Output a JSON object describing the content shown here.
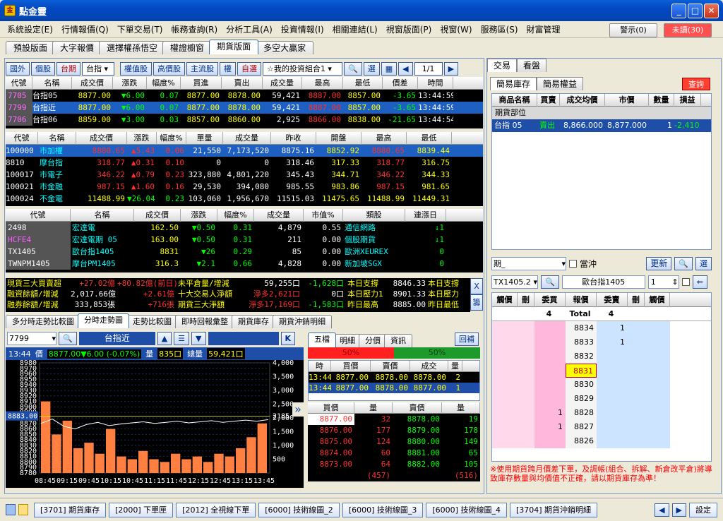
{
  "window": {
    "title": "點金靈"
  },
  "menu": [
    "系統設定(E)",
    "行情報價(Q)",
    "下單交易(T)",
    "帳務查詢(R)",
    "分析工具(A)",
    "投資情報(I)",
    "相關連結(L)",
    "視窗版面(P)",
    "視窗(W)",
    "服務區(S)",
    "財富管理"
  ],
  "alerts": {
    "warning": "警示(0)",
    "unread": "未讀(30)"
  },
  "page_tabs": [
    "預設版面",
    "大字報價",
    "選擇權孫悟空",
    "權證櫥窗",
    "期貨版面",
    "多空大贏家"
  ],
  "toolbar": {
    "buttons": [
      "國外",
      "個股",
      "台期",
      "權值股",
      "高價股",
      "主流股",
      "權",
      "自選"
    ],
    "dropdown1": "台指",
    "portfolio": "☆我的投資組合1",
    "search_label": "選",
    "page": "1/1"
  },
  "futures_table": {
    "headers": [
      "代號",
      "名稱",
      "成交價",
      "漲跌",
      "幅度%",
      "買進",
      "賣出",
      "成交量",
      "最高",
      "最低",
      "價差",
      "時間"
    ],
    "rows": [
      [
        "7705",
        "台指05",
        "8877.00",
        "▼6.00",
        "0.07",
        "8877.00",
        "8878.00",
        "59,421",
        "8887.00",
        "8857.00",
        "-3.65",
        "13:44:59"
      ],
      [
        "7799",
        "台指近",
        "8877.00",
        "▼6.00",
        "0.07",
        "8877.00",
        "8878.00",
        "59,421",
        "8887.00",
        "8857.00",
        "-3.65",
        "13:44:59"
      ],
      [
        "7706",
        "台指06",
        "8859.00",
        "▼3.00",
        "0.03",
        "8857.00",
        "8860.00",
        "2,925",
        "8866.00",
        "8838.00",
        "-21.65",
        "13:44:54"
      ]
    ]
  },
  "index_table": {
    "headers": [
      "代號",
      "名稱",
      "成交價",
      "漲跌",
      "幅度%",
      "單量",
      "成交量",
      "昨收",
      "開盤",
      "最高",
      "最低"
    ],
    "rows": [
      [
        "100000",
        "市加權",
        "8880.65",
        "▲5.43",
        "0.06",
        "21,550",
        "7,173,520",
        "8875.16",
        "8852.92",
        "8880.65",
        "8839.44"
      ],
      [
        "8810",
        "摩台指",
        "318.77",
        "▲0.31",
        "0.10",
        "0",
        "0",
        "318.46",
        "317.33",
        "318.77",
        "316.75"
      ],
      [
        "100017",
        "市電子",
        "346.22",
        "▲0.79",
        "0.23",
        "323,880",
        "4,801,220",
        "345.43",
        "344.71",
        "346.22",
        "344.33"
      ],
      [
        "100021",
        "市金融",
        "987.15",
        "▲1.60",
        "0.16",
        "29,530",
        "394,080",
        "985.55",
        "983.86",
        "987.15",
        "981.65"
      ],
      [
        "100024",
        "不金電",
        "11488.99",
        "▼26.04",
        "0.23",
        "103,060",
        "1,956,670",
        "11515.03",
        "11475.65",
        "11488.99",
        "11449.31"
      ]
    ]
  },
  "stock_table": {
    "headers": [
      "代號",
      "名稱",
      "成交價",
      "漲跌",
      "幅度%",
      "成交量",
      "市值%",
      "類股",
      "連漲日"
    ],
    "rows": [
      [
        "2498",
        "宏達電",
        "162.50",
        "▼0.50",
        "0.31",
        "4,879",
        "0.55",
        "通信網路",
        "↓1"
      ],
      [
        "HCFE4",
        "宏達電期 05",
        "163.00",
        "▼0.50",
        "0.31",
        "211",
        "0.00",
        "個股期貨",
        "↓1"
      ],
      [
        "TX1405",
        "歐台指1405",
        "8831",
        "▼26",
        "0.29",
        "85",
        "0.00",
        "歐洲XEUREX",
        "0"
      ],
      [
        "TWNPM1405",
        "摩台PM1405",
        "316.3",
        "▼2.1",
        "0.66",
        "4,828",
        "0.00",
        "新加坡SGX",
        "0"
      ]
    ]
  },
  "market_summary": {
    "rows": [
      [
        [
          "現貨三大買賣超",
          "y"
        ],
        [
          "+27.02億",
          "r"
        ],
        [
          "+80.82億(前日)",
          "r"
        ],
        [
          "未平倉量/增減",
          "y"
        ],
        [
          "59,255口",
          "w"
        ],
        [
          "-1,628口",
          "g"
        ],
        [
          "本日支撐",
          "y"
        ],
        [
          "8846.33",
          "w"
        ],
        [
          "本日支撐",
          "y"
        ]
      ],
      [
        [
          "融資餘額/增減",
          "y"
        ],
        [
          "2,017.66億",
          "w"
        ],
        [
          "+2.61億",
          "r"
        ],
        [
          "十大交易人淨額",
          "y"
        ],
        [
          "淨多2,621口",
          "r"
        ],
        [
          "0口",
          "w"
        ],
        [
          "本日壓力1",
          "y"
        ],
        [
          "8901.33",
          "w"
        ],
        [
          "本日壓力",
          "y"
        ]
      ],
      [
        [
          "融券餘額/增減",
          "y"
        ],
        [
          "333,853張",
          "w"
        ],
        [
          "+716張",
          "r"
        ],
        [
          "期貨三大淨額",
          "y"
        ],
        [
          "淨多17,169口",
          "r"
        ],
        [
          "-1,583口",
          "g"
        ],
        [
          "昨日最高",
          "y"
        ],
        [
          "8885.00",
          "w"
        ],
        [
          "昨日最低",
          "y"
        ]
      ]
    ],
    "side_buttons": [
      "Ⅹ",
      "籌"
    ]
  },
  "chart_tabs": [
    "多分時走勢比較圖",
    "分時走勢圖",
    "走勢比較圖",
    "即時回報彙整",
    "期貨庫存",
    "期貨沖銷明細"
  ],
  "chart_panel": {
    "symbol": "7799",
    "name": "台指近",
    "time": "13:44",
    "price_label": "價",
    "price": "8877.00▼6.00 (-0.07%)",
    "vol_label": "量",
    "vol": "835口",
    "total_label": "總量",
    "total": "59,421口",
    "k_btn": "K",
    "current_price_tag": "8883.00",
    "right_price_tag": "2185",
    "expand": "»"
  },
  "chart_data": {
    "type": "line",
    "yticks": [
      "8980",
      "8970",
      "8960",
      "8950",
      "8940",
      "8930",
      "8920",
      "8910",
      "8900",
      "8890",
      "8880",
      "8870",
      "8860",
      "8850",
      "8840",
      "8830",
      "8820",
      "8810",
      "8800",
      "8790",
      "8780"
    ],
    "y2ticks": [
      "4,000",
      "3,500",
      "3,000",
      "2,500",
      "2,000",
      "1,500",
      "1,000",
      "500"
    ],
    "xticks": [
      "08:45",
      "09:15",
      "09:45",
      "10:15",
      "10:45",
      "11:15",
      "11:45",
      "12:15",
      "12:45",
      "13:15",
      "13:45"
    ],
    "ylim": [
      8780,
      8980
    ],
    "y2lim": [
      0,
      4000
    ],
    "series": [
      {
        "values": [
          8870,
          8878,
          8865,
          8860,
          8868,
          8872,
          8866,
          8869,
          8871,
          8873,
          8870,
          8872,
          8874,
          8871,
          8873,
          8875,
          8872,
          8874,
          8876,
          8874,
          8877
        ]
      }
    ],
    "volume": [
      2600,
      1400,
      1900,
      900,
      1100,
      700,
      1600,
      600,
      500,
      800,
      500,
      400,
      700,
      500,
      600,
      400,
      700,
      600,
      900,
      1300,
      1800
    ]
  },
  "quote_tabs": [
    "五檔",
    "明細",
    "分價",
    "資訊"
  ],
  "quote_return": "回補",
  "ratio": {
    "left": "50%",
    "right": "50%"
  },
  "tick_table": {
    "headers": [
      "時",
      "買價",
      "賣價",
      "成交",
      "量"
    ],
    "rows": [
      [
        "13:44",
        "8877.00",
        "8878.00",
        "8878.00",
        "2"
      ],
      [
        "13:44",
        "8877.00",
        "8878.00",
        "8877.00",
        "1"
      ]
    ]
  },
  "depth_table": {
    "headers": [
      "買價",
      "量",
      "賣價",
      "量"
    ],
    "rows": [
      [
        "8877.00",
        "32",
        "8878.00",
        "19"
      ],
      [
        "8876.00",
        "177",
        "8879.00",
        "178"
      ],
      [
        "8875.00",
        "124",
        "8880.00",
        "149"
      ],
      [
        "8874.00",
        "60",
        "8881.00",
        "65"
      ],
      [
        "8873.00",
        "64",
        "8882.00",
        "105"
      ]
    ],
    "totals": [
      "(457)",
      "(516)"
    ]
  },
  "right_tabs": [
    "交易",
    "看盤"
  ],
  "inv_tabs": [
    "簡易庫存",
    "簡易權益"
  ],
  "query_btn": "查詢",
  "inventory": {
    "headers": [
      "商品名稱",
      "買賣",
      "成交均價",
      "市價",
      "數量",
      "損益"
    ],
    "section": "期貨部位",
    "rows": [
      [
        "台指 05",
        "賣出",
        "8,866.000",
        "8,877.000",
        "1",
        "-2,410"
      ]
    ]
  },
  "order": {
    "type": "期_",
    "daytrade": "當沖",
    "refresh": "更新",
    "symbol": "TX1405.2",
    "name": "歐台指1405",
    "qty": "1"
  },
  "ladder": {
    "headers": [
      "觸價",
      "刪",
      "委買",
      "報價",
      "委賣",
      "刪",
      "觸價"
    ],
    "totals": [
      "4",
      "Total",
      "4"
    ],
    "rows": [
      [
        "",
        "",
        "",
        "8834",
        "1",
        "",
        ""
      ],
      [
        "",
        "",
        "",
        "8833",
        "1",
        "",
        ""
      ],
      [
        "",
        "",
        "",
        "8832",
        "",
        "",
        ""
      ],
      [
        "",
        "",
        "",
        "8831",
        "",
        "",
        ""
      ],
      [
        "",
        "",
        "",
        "8830",
        "",
        "",
        ""
      ],
      [
        "",
        "",
        "",
        "8829",
        "",
        "",
        ""
      ],
      [
        "",
        "",
        "1",
        "8828",
        "",
        "",
        ""
      ],
      [
        "",
        "",
        "1",
        "8827",
        "",
        "",
        ""
      ],
      [
        "",
        "",
        "",
        "8826",
        "",
        "",
        ""
      ]
    ],
    "current": "8831"
  },
  "warning_note": "※使用期貨跨月價差下單，及調帳(組合、拆解、新倉改平倉)將導致庫存數量與均價值不正確，請以期貨庫存為準！",
  "taskbar": [
    "[3701] 期貨庫存",
    "[2000] 下單匣",
    "[2012] 全視線下單",
    "[6000] 技術線圖_2",
    "[6000] 技術線圖_3",
    "[6000] 技術線圖_4",
    "[3704] 期貨沖銷明細"
  ],
  "settings": "設定"
}
